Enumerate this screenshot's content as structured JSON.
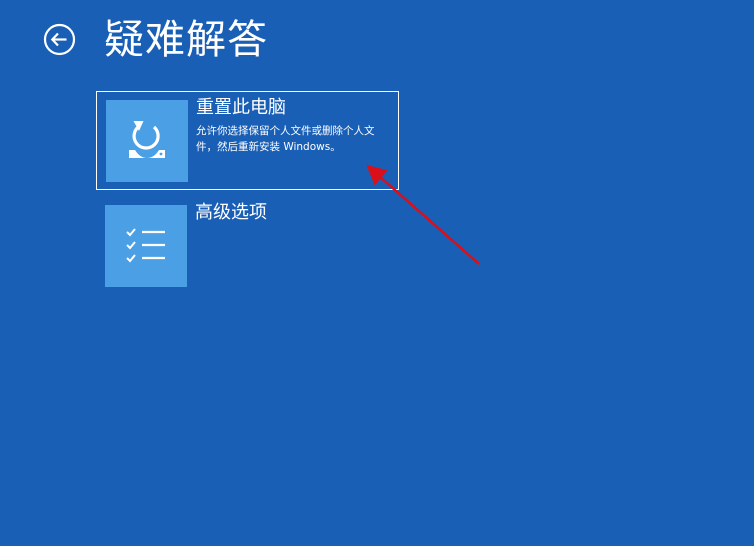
{
  "header": {
    "title": "疑难解答",
    "back_icon": "back-arrow-circle-icon"
  },
  "options": [
    {
      "title": "重置此电脑",
      "description": "允许你选择保留个人文件或删除个人文件，然后重新安装 Windows。",
      "icon": "reset-pc-icon",
      "selected": true
    },
    {
      "title": "高级选项",
      "description": "",
      "icon": "checklist-icon",
      "selected": false
    }
  ],
  "colors": {
    "background": "#1a5fb6",
    "tile": "#4a9fe5",
    "text": "#ffffff",
    "annotation_arrow": "#d9101a"
  }
}
